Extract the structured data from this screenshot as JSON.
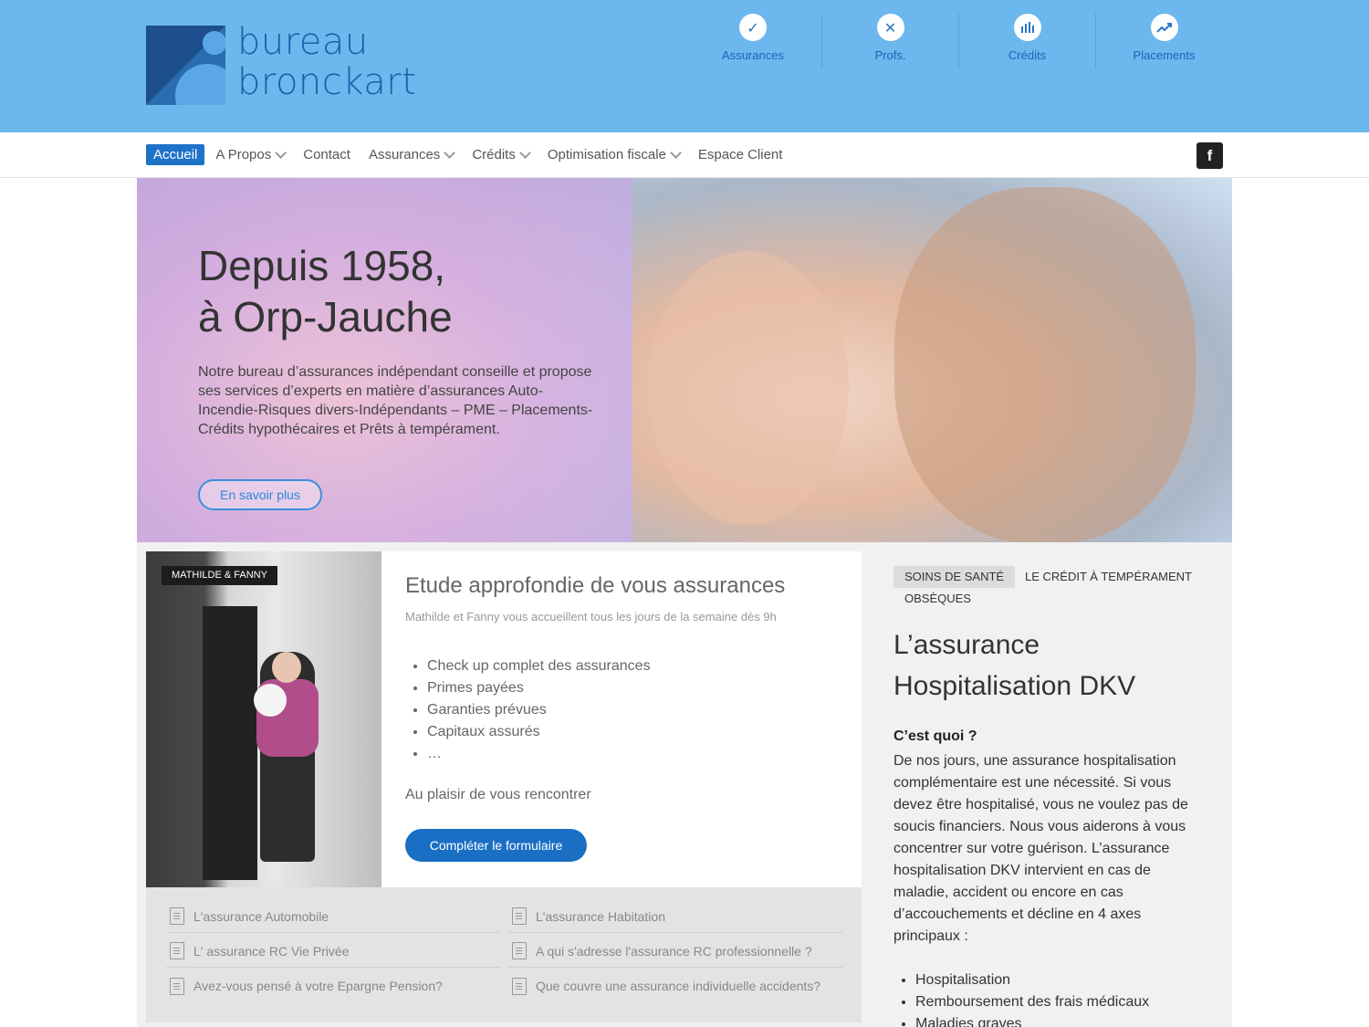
{
  "brand": {
    "line1": "bureau",
    "line2": "bronckart"
  },
  "quick_nav": [
    {
      "label": "Assurances",
      "icon": "checkbox-icon"
    },
    {
      "label": "Profs.",
      "icon": "tools-icon"
    },
    {
      "label": "Crédits",
      "icon": "bar-chart-icon"
    },
    {
      "label": "Placements",
      "icon": "trend-up-icon"
    }
  ],
  "menu": [
    {
      "label": "Accueil"
    },
    {
      "label": "A Propos"
    },
    {
      "label": "Contact"
    },
    {
      "label": "Assurances"
    },
    {
      "label": "Crédits"
    },
    {
      "label": "Optimisation fiscale"
    },
    {
      "label": "Espace Client"
    }
  ],
  "social": {
    "facebook": "f"
  },
  "hero": {
    "title": "Depuis 1958,\nà Orp-Jauche",
    "text": "Notre bureau d’assurances indépendant conseille et propose ses services d’experts en matière d’assurances Auto-Incendie-Risques divers-Indépendants – PME – Placements-Crédits hypothécaires et Prêts à tempérament.",
    "button": "En savoir plus"
  },
  "card": {
    "tag": "MATHILDE & FANNY",
    "title": "Etude approfondie de vous assurances",
    "subtitle": "Mathilde et Fanny vous accueillent tous les jours de la semaine dès 9h",
    "items": [
      "Check up complet des assurances",
      "Primes payées",
      "Garanties prévues",
      "Capitaux assurés",
      "…"
    ],
    "note": "Au plaisir de vous rencontrer",
    "button": "Compléter le formulaire"
  },
  "links": [
    "L'assurance Automobile",
    "L'assurance Habitation",
    "L' assurance RC Vie Privée",
    "A qui s'adresse l'assurance RC professionnelle ?",
    "Avez-vous pensé à votre Epargne Pension?",
    "Que couvre une assurance individuelle accidents?"
  ],
  "tabs": [
    "SOINS DE SANTÉ",
    "LE CRÉDIT À TEMPÉRAMENT",
    "OBSÈQUES"
  ],
  "article": {
    "title": "L’assurance Hospitalisation DKV",
    "heading": "C’est quoi ?",
    "body": "De nos jours, une assurance hospitalisation complémentaire est une nécessité. Si vous devez être hospitalisé, vous ne voulez pas de soucis financiers. Nous vous aiderons à vous concentrer sur votre guérison. L’assurance hospitalisation DKV intervient en cas de maladie, accident ou encore en cas d’accouchements et décline en 4 axes principaux :",
    "items": [
      "Hospitalisation",
      "Remboursement des frais médicaux",
      "Maladies graves"
    ]
  }
}
